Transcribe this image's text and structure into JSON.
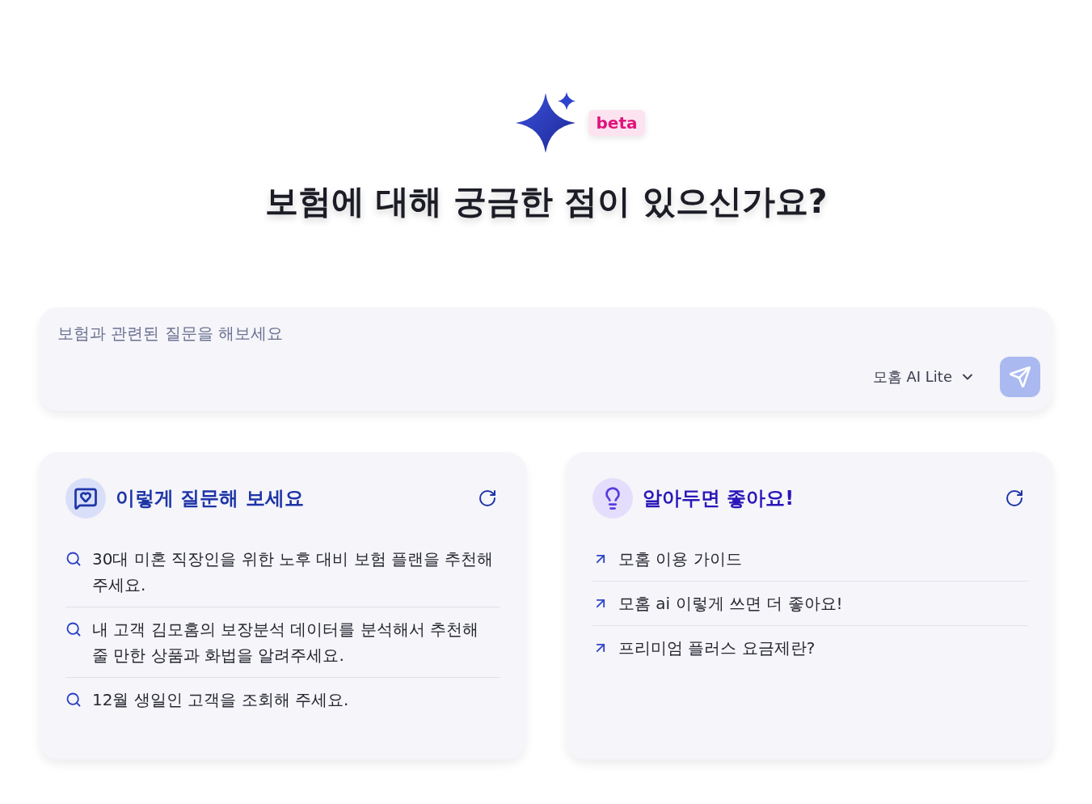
{
  "hero": {
    "badge": "beta",
    "title": "보험에 대해 궁금한 점이 있으신가요?"
  },
  "composer": {
    "placeholder": "보험과 관련된 질문을 해보세요",
    "model": "모홈 AI Lite",
    "send": {
      "disabled": true
    }
  },
  "cards": [
    {
      "kind": "questions",
      "title": "이렇게 질문해 보세요",
      "items": [
        "30대 미혼 직장인을 위한 노후 대비 보험 플랜을 추천해 주세요.",
        "내 고객 김모홈의 보장분석 데이터를 분석해서 추천해 줄 만한 상품과 화법을 알려주세요.",
        "12월 생일인 고객을 조회해 주세요."
      ]
    },
    {
      "kind": "tips",
      "title": "알아두면 좋아요!",
      "items": [
        "모홈 이용 가이드",
        "모홈 ai 이렇게 쓰면 더 좋아요!",
        "프리미엄 플러스 요금제란?"
      ]
    }
  ]
}
